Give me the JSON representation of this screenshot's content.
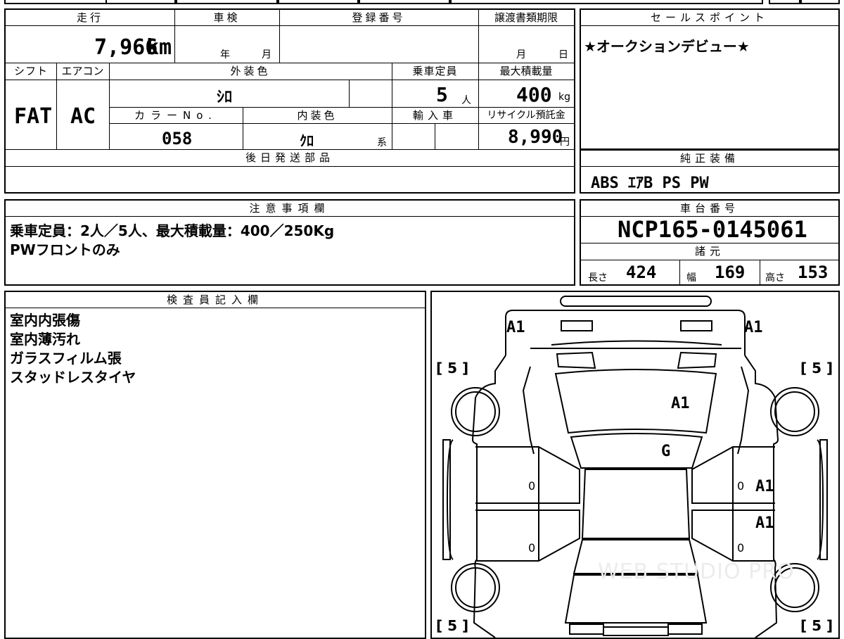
{
  "vehicle_sheet": {
    "mileage": {
      "label": "走行",
      "value": "7,966",
      "unit": "km"
    },
    "inspection": {
      "label": "車検",
      "year_unit": "年",
      "month_unit": "月"
    },
    "registration": {
      "label": "登録番号",
      "value": ""
    },
    "transfer_deadline": {
      "label": "譲渡書類期限",
      "month_unit": "月",
      "day_unit": "日"
    },
    "shift": {
      "label": "シフト",
      "value": "FAT"
    },
    "aircon": {
      "label": "エアコン",
      "value": "AC"
    },
    "exterior_color": {
      "label": "外装色",
      "value": "ｼﾛ"
    },
    "capacity": {
      "label": "乗車定員",
      "value": "5",
      "unit": "人"
    },
    "max_load": {
      "label": "最大積載量",
      "value": "400",
      "unit": "kg"
    },
    "color_no": {
      "label": "カラーNo.",
      "value": "058"
    },
    "interior_color": {
      "label": "内装色",
      "value": "ｸﾛ",
      "suffix": "系"
    },
    "import": {
      "label": "輸入車",
      "value": ""
    },
    "recycle_fee": {
      "label": "リサイクル預託金",
      "value": "8,990",
      "unit": "円"
    },
    "later_parts": {
      "label": "後日発送部品",
      "value": ""
    }
  },
  "sales_point": {
    "label": "セールスポイント",
    "text": "★オークションデビュー★"
  },
  "standard_equipment": {
    "label": "純正装備",
    "text": "ABS ｴｱB PS PW"
  },
  "notes": {
    "label": "注意事項欄",
    "lines": [
      "乗車定員：2人／5人、最大積載量：400／250Kg",
      "PWフロントのみ"
    ]
  },
  "chassis": {
    "label": "車台番号",
    "value": "NCP165-0145061"
  },
  "dimensions": {
    "label": "諸元",
    "length": {
      "label": "長さ",
      "value": "424"
    },
    "width": {
      "label": "幅",
      "value": "169"
    },
    "height": {
      "label": "高さ",
      "value": "153"
    }
  },
  "inspector": {
    "label": "検査員記入欄",
    "lines": [
      "室内内張傷",
      "室内薄汚れ",
      "ガラスフィルム張",
      "スタッドレスタイヤ"
    ]
  },
  "diagram": {
    "marks": {
      "front_left": "A1",
      "front_right": "A1",
      "hood": "A1",
      "windshield": "G",
      "right_door_front": "A1",
      "right_door_rear": "A1",
      "left_door_front_zero": "0",
      "left_door_rear_zero": "0",
      "right_door_front_zero": "0",
      "right_door_rear_zero": "0"
    },
    "tires": {
      "front_left": "5",
      "front_right": "5",
      "rear_left": "5",
      "rear_right": "5"
    },
    "watermark": "WEB STUDIO PRO"
  }
}
